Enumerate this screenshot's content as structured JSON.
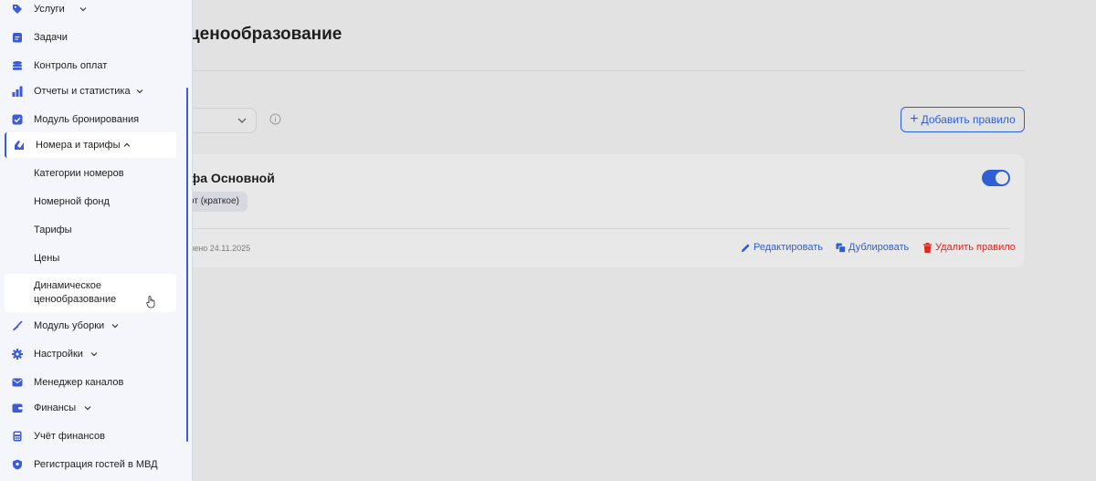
{
  "colors": {
    "accent": "#2f5fd6",
    "danger": "#e0261e",
    "sidebar_bg": "#f5f6fc",
    "overlay_bg": "#e2e2e2"
  },
  "page": {
    "title": "ценообразование",
    "add_rule_label": "Добавить правило"
  },
  "rule_card": {
    "title": "фа Основной",
    "badge": "от (краткое)",
    "updated": "лено 24.11.2025",
    "toggle_on": true,
    "actions": {
      "edit": "Редактировать",
      "duplicate": "Дублировать",
      "delete": "Удалить правило"
    }
  },
  "sidebar": {
    "items": [
      {
        "label": "Услуги",
        "icon": "tag-icon",
        "expandable": true
      },
      {
        "label": "Задачи",
        "icon": "clipboard-icon",
        "expandable": false
      },
      {
        "label": "Контроль оплат",
        "icon": "coins-icon",
        "expandable": false
      },
      {
        "label": "Отчеты и статистика",
        "icon": "bar-chart-icon",
        "expandable": true
      },
      {
        "label": "Модуль бронирования",
        "icon": "checkbox-icon",
        "expandable": false
      },
      {
        "label": "Номера и тарифы",
        "icon": "key-icon",
        "expandable": true,
        "expanded": true
      },
      {
        "label": "Модуль уборки",
        "icon": "broom-icon",
        "expandable": true
      },
      {
        "label": "Настройки",
        "icon": "gear-icon",
        "expandable": true
      },
      {
        "label": "Менеджер каналов",
        "icon": "envelope-icon",
        "expandable": false
      },
      {
        "label": "Финансы",
        "icon": "wallet-icon",
        "expandable": true
      },
      {
        "label": "Учёт финансов",
        "icon": "calculator-icon",
        "expandable": false
      },
      {
        "label": "Регистрация гостей в МВД",
        "icon": "shield-icon",
        "expandable": false
      }
    ],
    "subitems": [
      {
        "label": "Категории номеров"
      },
      {
        "label": "Номерной фонд"
      },
      {
        "label": "Тарифы"
      },
      {
        "label": "Цены"
      },
      {
        "label": "Динамическое ценообразование",
        "hover": true
      }
    ]
  }
}
